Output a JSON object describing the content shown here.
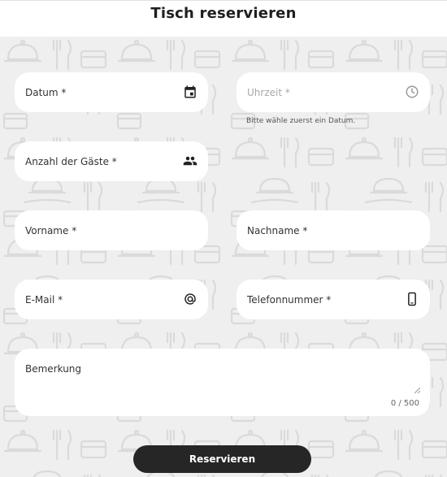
{
  "title": "Tisch reservieren",
  "fields": {
    "date": {
      "label": "Datum *",
      "icon": "calendar-icon"
    },
    "time": {
      "label": "Uhrzeit *",
      "icon": "clock-icon",
      "hint": "Bitte wähle zuerst ein Datum."
    },
    "guests": {
      "label": "Anzahl der Gäste *",
      "icon": "people-icon"
    },
    "first_name": {
      "label": "Vorname *"
    },
    "last_name": {
      "label": "Nachname *"
    },
    "email": {
      "label": "E-Mail *",
      "icon": "at-icon"
    },
    "phone": {
      "label": "Telefonnummer *",
      "icon": "smartphone-icon"
    },
    "remarks": {
      "label": "Bemerkung",
      "counter": "0 / 500"
    }
  },
  "submit_label": "Reservieren",
  "colors": {
    "background": "#efefef",
    "field": "#ffffff",
    "button": "#262626",
    "pattern": "#d9d9d9"
  }
}
